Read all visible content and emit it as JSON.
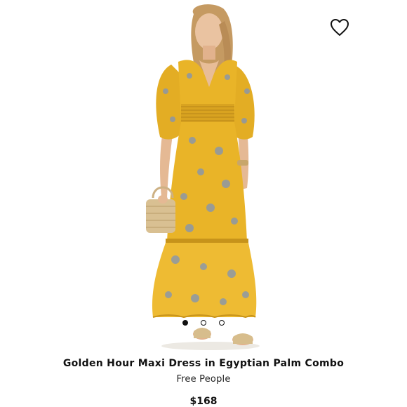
{
  "product": {
    "title": "Golden Hour Maxi Dress in Egyptian Palm Combo",
    "brand": "Free People",
    "price": "$168"
  },
  "carousel": {
    "total": 3,
    "active_index": 0
  },
  "icons": {
    "favorite": "heart-outline-icon"
  },
  "colors": {
    "dress_yellow": "#e9b428",
    "dress_shadow": "#c7931a",
    "print_blue": "#7f93b8",
    "text": "#111111"
  }
}
